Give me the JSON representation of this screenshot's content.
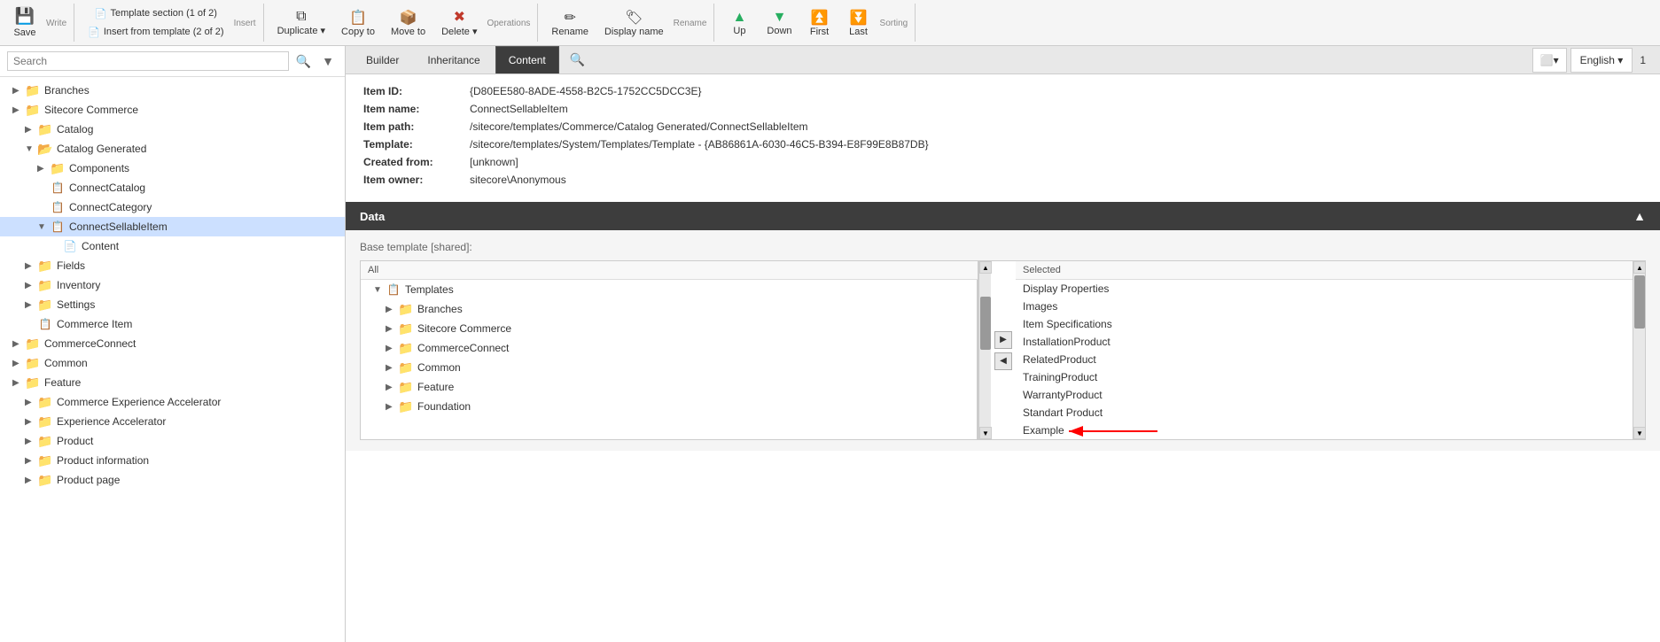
{
  "toolbar": {
    "groups": [
      {
        "name": "Write",
        "items": [
          {
            "label": "Save",
            "icon": "💾",
            "type": "blue",
            "name": "save-button"
          }
        ]
      },
      {
        "name": "Insert",
        "items": [
          {
            "label": "Template section (1 of 2)",
            "icon": "📄",
            "type": "normal",
            "name": "template-section-button"
          },
          {
            "label": "Insert from template (2 of 2)",
            "icon": "📄",
            "type": "normal",
            "name": "insert-from-template-button"
          }
        ]
      },
      {
        "name": "Operations",
        "items": [
          {
            "label": "Duplicate ▾",
            "icon": "⧉",
            "type": "normal",
            "name": "duplicate-button"
          },
          {
            "label": "Copy to",
            "icon": "📋",
            "type": "normal",
            "name": "copy-to-button"
          },
          {
            "label": "Move to",
            "icon": "📦",
            "type": "normal",
            "name": "move-to-button"
          },
          {
            "label": "Delete ▾",
            "icon": "✖",
            "type": "red",
            "name": "delete-button"
          }
        ]
      },
      {
        "name": "Rename",
        "items": [
          {
            "label": "Rename",
            "icon": "✏",
            "type": "normal",
            "name": "rename-button"
          },
          {
            "label": "Display name",
            "icon": "🏷",
            "type": "normal",
            "name": "display-name-button"
          }
        ]
      },
      {
        "name": "Sorting",
        "items": [
          {
            "label": "Up",
            "icon": "▲",
            "type": "green",
            "name": "up-button"
          },
          {
            "label": "Down",
            "icon": "▼",
            "type": "green",
            "name": "down-button"
          },
          {
            "label": "First",
            "icon": "⏫",
            "type": "green",
            "name": "first-button"
          },
          {
            "label": "Last",
            "icon": "⏬",
            "type": "green",
            "name": "last-button"
          }
        ]
      }
    ]
  },
  "search": {
    "placeholder": "Search"
  },
  "tabs": [
    {
      "label": "Builder",
      "active": false
    },
    {
      "label": "Inheritance",
      "active": false
    },
    {
      "label": "Content",
      "active": true
    }
  ],
  "lang_button": "English ▾",
  "item_info": {
    "id_label": "Item ID:",
    "id_value": "{D80EE580-8ADE-4558-B2C5-1752CC5DCC3E}",
    "name_label": "Item name:",
    "name_value": "ConnectSellableItem",
    "path_label": "Item path:",
    "path_value": "/sitecore/templates/Commerce/Catalog Generated/ConnectSellableItem",
    "template_label": "Template:",
    "template_value": "/sitecore/templates/System/Templates/Template - {AB86861A-6030-46C5-B394-E8F99E8B87DB}",
    "created_label": "Created from:",
    "created_value": "[unknown]",
    "owner_label": "Item owner:",
    "owner_value": "sitecore\\Anonymous"
  },
  "data_section": {
    "title": "Data",
    "base_template_label": "Base template",
    "base_template_shared": "[shared]",
    "all_label": "All",
    "selected_label": "Selected",
    "tree_items": [
      {
        "label": "Templates",
        "icon": "template",
        "level": 0,
        "expanded": true
      },
      {
        "label": "Branches",
        "icon": "folder",
        "level": 1,
        "expanded": false
      },
      {
        "label": "Sitecore Commerce",
        "icon": "folder",
        "level": 1,
        "expanded": false
      },
      {
        "label": "CommerceConnect",
        "icon": "folder",
        "level": 1,
        "expanded": false
      },
      {
        "label": "Common",
        "icon": "folder",
        "level": 1,
        "expanded": false
      },
      {
        "label": "Feature",
        "icon": "folder",
        "level": 1,
        "expanded": false
      },
      {
        "label": "Foundation",
        "icon": "folder",
        "level": 1,
        "expanded": false
      }
    ],
    "selected_items": [
      {
        "label": "Display Properties"
      },
      {
        "label": "Images"
      },
      {
        "label": "Item Specifications"
      },
      {
        "label": "InstallationProduct"
      },
      {
        "label": "RelatedProduct"
      },
      {
        "label": "TrainingProduct"
      },
      {
        "label": "WarrantyProduct"
      },
      {
        "label": "Standart Product"
      },
      {
        "label": "Example"
      }
    ]
  },
  "sidebar_tree": [
    {
      "label": "Branches",
      "icon": "folder",
      "level": 0,
      "expanded": false
    },
    {
      "label": "Sitecore Commerce",
      "icon": "folder",
      "level": 0,
      "expanded": false
    },
    {
      "label": "Catalog",
      "icon": "folder",
      "level": 1,
      "expanded": false
    },
    {
      "label": "Catalog Generated",
      "icon": "folder",
      "level": 1,
      "expanded": true
    },
    {
      "label": "Components",
      "icon": "folder",
      "level": 2,
      "expanded": false
    },
    {
      "label": "ConnectCatalog",
      "icon": "template",
      "level": 2,
      "expanded": false
    },
    {
      "label": "ConnectCategory",
      "icon": "template",
      "level": 2,
      "expanded": false
    },
    {
      "label": "ConnectSellableItem",
      "icon": "template",
      "level": 2,
      "expanded": true,
      "selected": true
    },
    {
      "label": "Content",
      "icon": "page",
      "level": 3,
      "expanded": false
    },
    {
      "label": "Fields",
      "icon": "folder",
      "level": 1,
      "expanded": false
    },
    {
      "label": "Inventory",
      "icon": "folder",
      "level": 1,
      "expanded": false
    },
    {
      "label": "Settings",
      "icon": "folder",
      "level": 1,
      "expanded": false
    },
    {
      "label": "Commerce Item",
      "icon": "template",
      "level": 1,
      "expanded": false
    },
    {
      "label": "CommerceConnect",
      "icon": "folder",
      "level": 0,
      "expanded": false
    },
    {
      "label": "Common",
      "icon": "folder",
      "level": 0,
      "expanded": false
    },
    {
      "label": "Feature",
      "icon": "folder",
      "level": 0,
      "expanded": false
    },
    {
      "label": "Commerce Experience Accelerator",
      "icon": "folder",
      "level": 1,
      "expanded": false
    },
    {
      "label": "Experience Accelerator",
      "icon": "folder",
      "level": 1,
      "expanded": false
    },
    {
      "label": "Product",
      "icon": "folder",
      "level": 1,
      "expanded": false
    },
    {
      "label": "Product information",
      "icon": "folder",
      "level": 1,
      "expanded": false
    },
    {
      "label": "Product page",
      "icon": "folder",
      "level": 1,
      "expanded": false
    }
  ]
}
